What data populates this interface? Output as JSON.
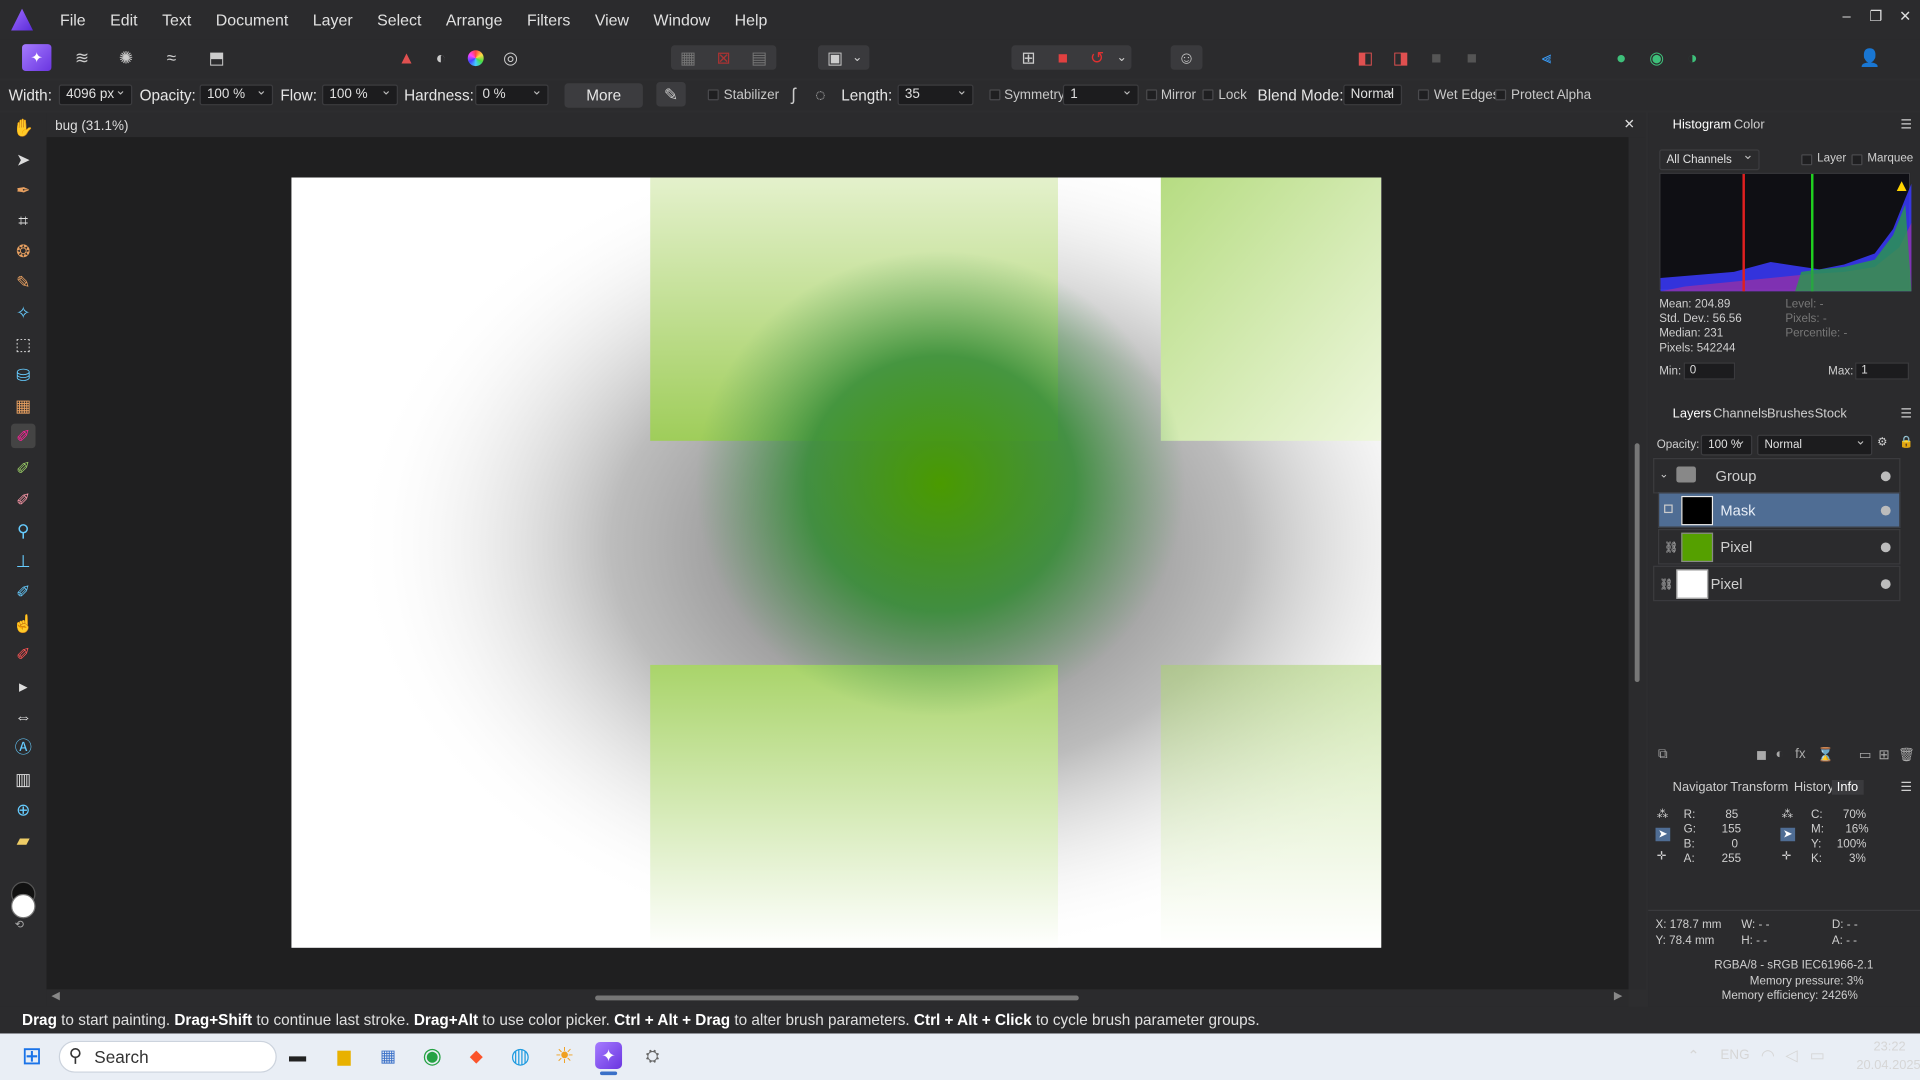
{
  "menu": [
    "File",
    "Edit",
    "Text",
    "Document",
    "Layer",
    "Select",
    "Arrange",
    "Filters",
    "View",
    "Window",
    "Help"
  ],
  "window_controls": {
    "minimize": "–",
    "restore": "❐",
    "close": "✕"
  },
  "context": {
    "width_label": "Width:",
    "width_value": "4096 px",
    "opacity_label": "Opacity:",
    "opacity_value": "100 %",
    "flow_label": "Flow:",
    "flow_value": "100 %",
    "hardness_label": "Hardness:",
    "hardness_value": "0 %",
    "more_label": "More",
    "stabilizer_label": "Stabilizer",
    "length_label": "Length:",
    "length_value": "35",
    "symmetry_label": "Symmetry",
    "symmetry_value": "1",
    "mirror_label": "Mirror",
    "lock_label": "Lock",
    "blend_label": "Blend Mode:",
    "blend_value": "Normal",
    "wet_edges_label": "Wet Edges",
    "protect_alpha_label": "Protect Alpha"
  },
  "document": {
    "tab_title": "bug (31.1%)",
    "close": "✕"
  },
  "status": {
    "s1": "Drag",
    " t1": " to start painting. ",
    "s2": "Drag+Shift",
    "t2": " to continue last stroke. ",
    "s3": "Drag+Alt",
    "t3": " to use color picker. ",
    "s4": "Ctrl + Alt + Drag",
    "t4": " to alter brush parameters. ",
    "s5": "Ctrl + Alt + Click",
    "t5": " to cycle brush parameter groups."
  },
  "histogram": {
    "tabs": [
      "Histogram",
      "Color"
    ],
    "channel": "All Channels",
    "layer_label": "Layer",
    "marquee_label": "Marquee",
    "mean": "Mean: 204.89",
    "stddev": "Std. Dev.: 56.56",
    "median": "Median: 231",
    "pixels": "Pixels: 542244",
    "level": "Level: -",
    "rpixels": "Pixels: -",
    "percentile": "Percentile: -",
    "min_label": "Min:",
    "min_value": "0",
    "max_label": "Max:",
    "max_value": "1"
  },
  "layers_panel": {
    "tabs": [
      "Layers",
      "Channels",
      "Brushes",
      "Stock"
    ],
    "opacity_label": "Opacity:",
    "opacity_value": "100 %",
    "blend": "Normal",
    "layers": [
      {
        "name": "Group"
      },
      {
        "name": "Mask"
      },
      {
        "name": "Pixel"
      },
      {
        "name": "Pixel"
      }
    ]
  },
  "info_panel": {
    "tabs": [
      "Navigator",
      "Transform",
      "History",
      "Info"
    ],
    "rgb": [
      [
        "R:",
        "85"
      ],
      [
        "G:",
        "155"
      ],
      [
        "B:",
        "0"
      ],
      [
        "A:",
        "255"
      ]
    ],
    "cmyk": [
      [
        "C:",
        "70%"
      ],
      [
        "M:",
        "16%"
      ],
      [
        "Y:",
        "100%"
      ],
      [
        "K:",
        "3%"
      ]
    ],
    "x": "X: 178.7 mm",
    "y": "Y: 78.4 mm",
    "w": "W: - -",
    "h": "H: - -",
    "d": "D: - -",
    "a": "A: - -",
    "profile": "RGBA/8 - sRGB IEC61966-2.1",
    "memory_pressure": "Memory pressure: 3%",
    "memory_efficiency": "Memory efficiency: 2426%"
  },
  "taskbar": {
    "search_placeholder": "Search",
    "lang": "ENG",
    "time": "23:22",
    "date": "20.04.2025"
  },
  "colors": {
    "accent": "#4f6d94",
    "green": "#55a000",
    "histogram_bg": "#1a1a2e"
  }
}
